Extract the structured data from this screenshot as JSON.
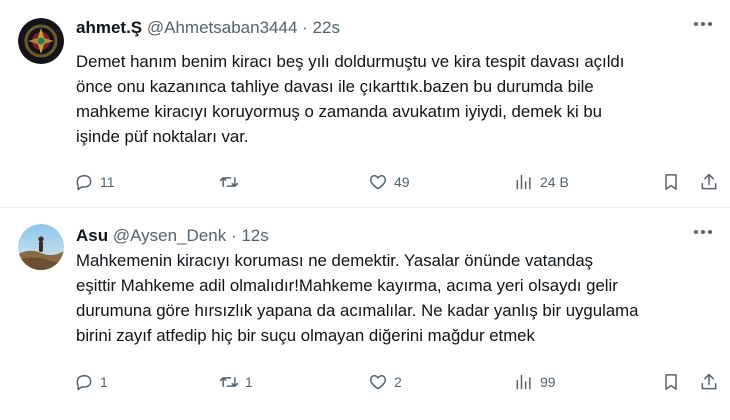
{
  "tweets": [
    {
      "name": "ahmet.Ş",
      "handle": "@Ahmetsaban3444",
      "separator": "·",
      "time": "22s",
      "text_lines": [
        "Demet hanım benim kiracı beş yılı doldurmuştu ve kira tespit davası açıldı",
        "önce onu kazanınca tahliye davası ile çıkarttık.bazen bu durumda bile",
        "mahkeme kiracıyı koruyormuş o zamanda avukatım iyiydi, demek ki bu",
        "işinde püf noktaları var."
      ],
      "replies": "11",
      "retweets": "",
      "likes": "49",
      "views": "24 B"
    },
    {
      "name": "Asu",
      "handle": "@Aysen_Denk",
      "separator": "·",
      "time": "12s",
      "text_lines": [
        "Mahkemenin kiracıyı koruması  ne demektir. Yasalar önünde vatandaş",
        "eşittir Mahkeme adil olmalıdır!Mahkeme kayırma, acıma yeri olsaydı gelir",
        "durumuna göre hırsızlık yapana da  acımalılar. Ne kadar yanlış bir uygulama",
        "birini zayıf atfedip hiç bir suçu olmayan diğerini mağdur etmek"
      ],
      "replies": "1",
      "retweets": "1",
      "likes": "2",
      "views": "99"
    }
  ],
  "icons": {
    "reply": "reply-icon",
    "retweet": "retweet-icon",
    "like": "heart-icon",
    "views": "views-icon",
    "bookmark": "bookmark-icon",
    "share": "share-icon",
    "more": "more-icon"
  },
  "colors": {
    "text": "#0f1419",
    "secondary": "#536471",
    "divider": "#eff3f4"
  }
}
